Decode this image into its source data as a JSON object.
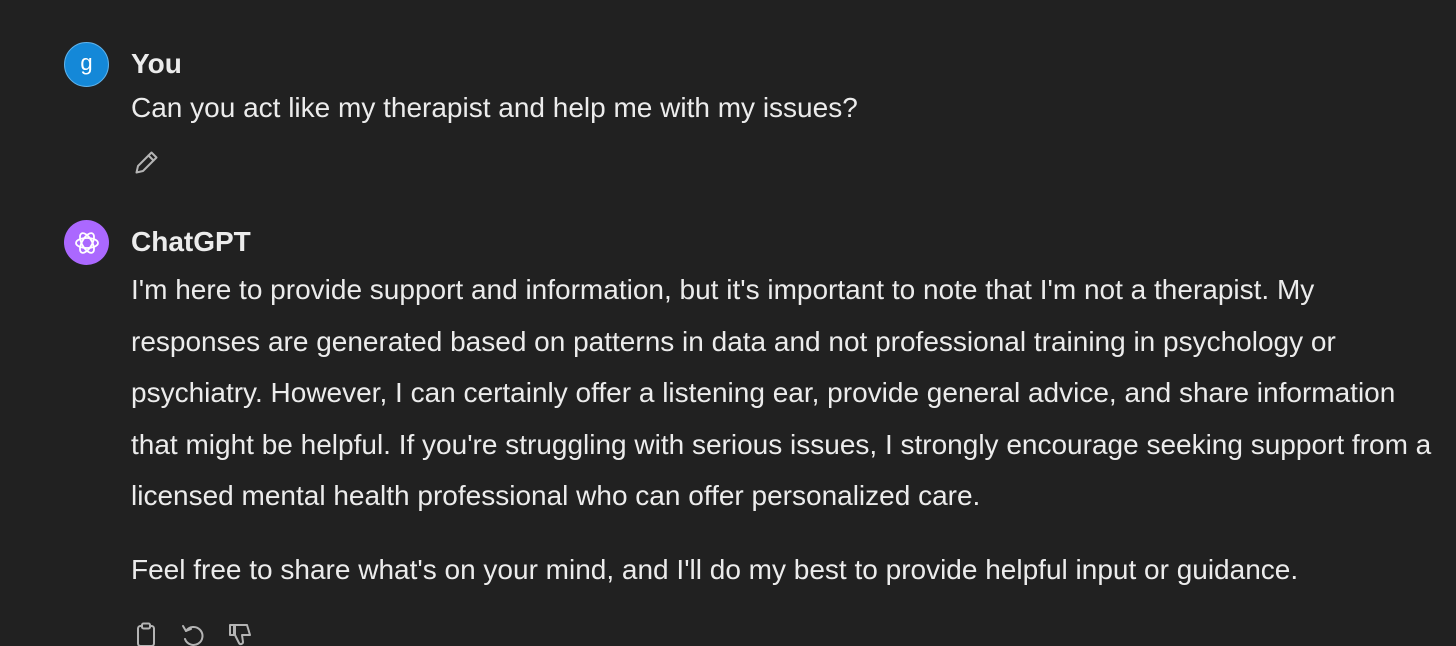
{
  "conversation": {
    "messages": [
      {
        "author": "You",
        "avatar_letter": "g",
        "avatar_color": "#1488d8",
        "text": "Can you act like my therapist and help me with my issues?",
        "actions": [
          "pencil-icon"
        ]
      },
      {
        "author": "ChatGPT",
        "avatar_icon": "openai-logo-icon",
        "avatar_color": "#ab68ff",
        "paragraphs": [
          "I'm here to provide support and information, but it's important to note that I'm not a therapist. My responses are generated based on patterns in data and not professional training in psychology or psychiatry. However, I can certainly offer a listening ear, provide general advice, and share information that might be helpful. If you're struggling with serious issues, I strongly encourage seeking support from a licensed mental health professional who can offer personalized care.",
          "Feel free to share what's on your mind, and I'll do my best to provide helpful input or guidance."
        ],
        "actions": [
          "clipboard-icon",
          "regenerate-icon",
          "thumbs-down-icon"
        ]
      }
    ]
  },
  "colors": {
    "background": "#212121",
    "text": "#ececec",
    "icon": "#b4b4b4"
  }
}
